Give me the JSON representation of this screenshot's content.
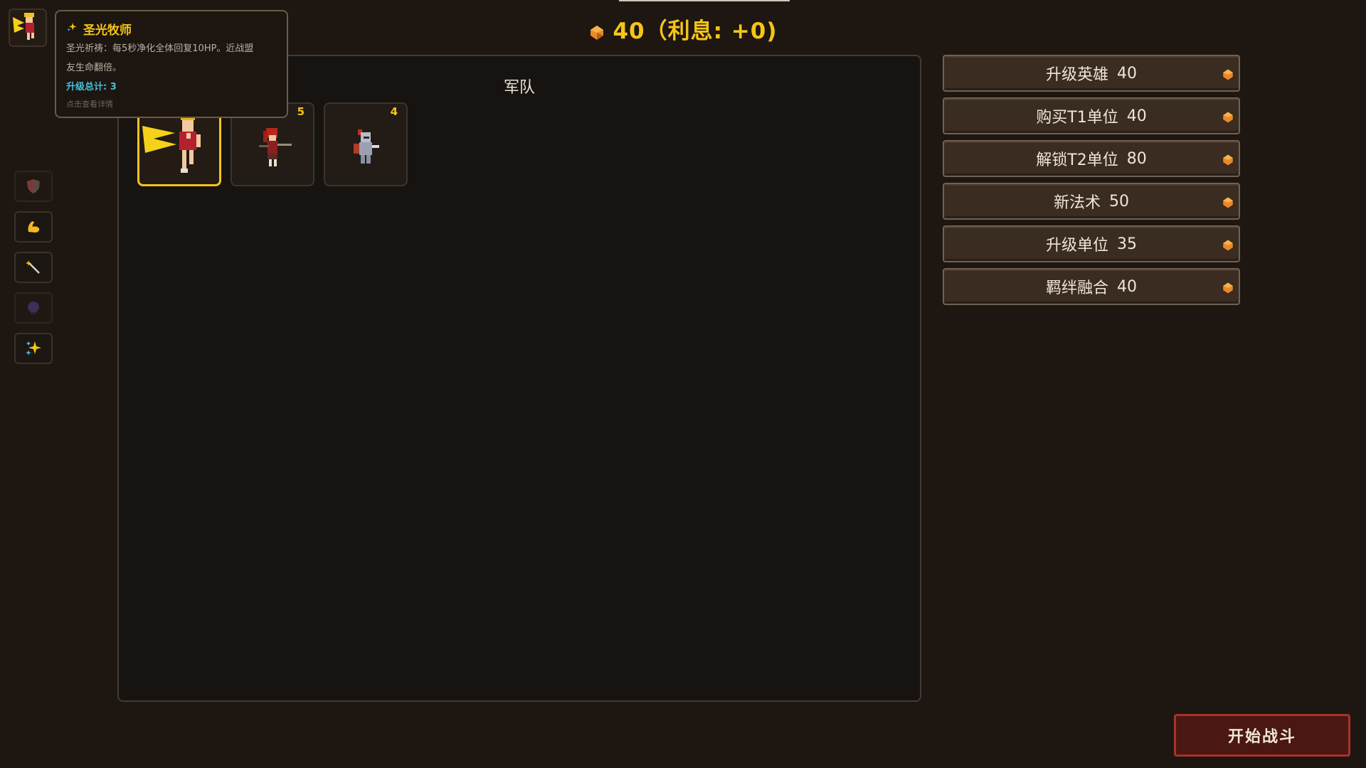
{
  "top": {
    "gold_text": "40（利息: +0)",
    "coin_icon": "gold-coin-icon"
  },
  "hero": {
    "portrait_icon": "winged-priestess-portrait"
  },
  "skills": [
    {
      "icon": "shield-icon",
      "active": false
    },
    {
      "icon": "flexed-arm-icon",
      "active": true
    },
    {
      "icon": "magic-wand-icon",
      "active": true
    },
    {
      "icon": "dark-orb-icon",
      "active": false
    },
    {
      "icon": "sparkles-icon",
      "active": true
    }
  ],
  "tooltip": {
    "title": "圣光牧师",
    "desc_line1": "圣光祈祷：每5秒净化全体回复10HP。近战盟",
    "desc_line2": "友生命翻倍。",
    "upgrade_total": "升级总计: 3",
    "hint": "点击查看详情"
  },
  "army": {
    "title": "军队",
    "units": [
      {
        "name": "winged-priestess",
        "count": ""
      },
      {
        "name": "red-haired-warrior",
        "count": "5"
      },
      {
        "name": "armored-knight",
        "count": "4"
      }
    ]
  },
  "shop": {
    "buttons": [
      {
        "label": "升级英雄",
        "cost": "40"
      },
      {
        "label": "购买T1单位",
        "cost": "40"
      },
      {
        "label": "解锁T2单位",
        "cost": "80"
      },
      {
        "label": "新法术",
        "cost": "50"
      },
      {
        "label": "升级单位",
        "cost": "35"
      },
      {
        "label": "羁绊融合",
        "cost": "40"
      }
    ]
  },
  "start_button": {
    "label": "开始战斗"
  },
  "colors": {
    "background": "#1e1611",
    "gold": "#f5c518",
    "upgrade_text": "#46c0d8",
    "start_border": "#a8332a"
  }
}
